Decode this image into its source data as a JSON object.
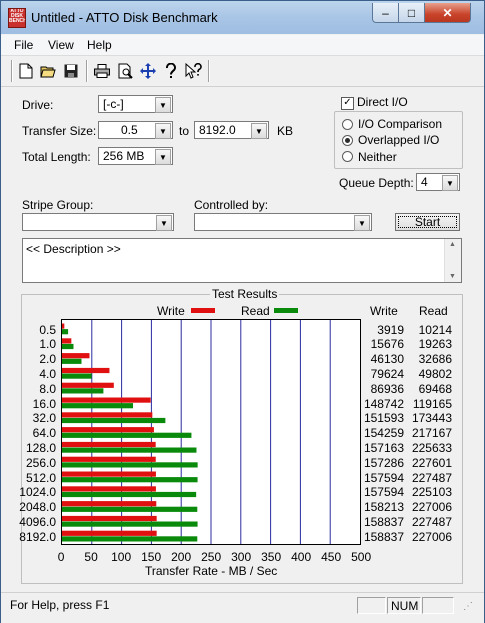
{
  "window": {
    "title": "Untitled - ATTO Disk Benchmark",
    "icon_text": "ATTO DISK BENCH"
  },
  "titlebar_buttons": {
    "minimize": "–",
    "maximize": "□",
    "close": "✕"
  },
  "menu": [
    "File",
    "View",
    "Help"
  ],
  "toolbar": {
    "icons": [
      "new-icon",
      "open-icon",
      "save-icon",
      "print-icon",
      "print-preview-icon",
      "move-icon",
      "help-icon",
      "context-help-icon"
    ]
  },
  "settings": {
    "drive_label": "Drive:",
    "drive_value": "[-c-]",
    "transfer_size_label": "Transfer Size:",
    "transfer_from": "0.5",
    "to_label": "to",
    "transfer_to": "8192.0",
    "kb_label": "KB",
    "total_length_label": "Total Length:",
    "total_length_value": "256 MB",
    "direct_io_label": "Direct I/O",
    "direct_io_checked": true,
    "io_comparison_label": "I/O Comparison",
    "overlapped_io_label": "Overlapped I/O",
    "neither_label": "Neither",
    "selected_mode": "Overlapped I/O",
    "queue_depth_label": "Queue Depth:",
    "queue_depth_value": "4",
    "stripe_group_label": "Stripe Group:",
    "stripe_group_value": "",
    "controlled_by_label": "Controlled by:",
    "controlled_by_value": "",
    "start_button": "Start",
    "description": "<< Description >>"
  },
  "results": {
    "title": "Test Results",
    "legend_write": "Write",
    "legend_read": "Read",
    "col_write": "Write",
    "col_read": "Read",
    "rows": [
      {
        "size": "0.5",
        "write": "3919",
        "read": "10214"
      },
      {
        "size": "1.0",
        "write": "15676",
        "read": "19263"
      },
      {
        "size": "2.0",
        "write": "46130",
        "read": "32686"
      },
      {
        "size": "4.0",
        "write": "79624",
        "read": "49802"
      },
      {
        "size": "8.0",
        "write": "86936",
        "read": "69468"
      },
      {
        "size": "16.0",
        "write": "148742",
        "read": "119165"
      },
      {
        "size": "32.0",
        "write": "151593",
        "read": "173443"
      },
      {
        "size": "64.0",
        "write": "154259",
        "read": "217167"
      },
      {
        "size": "128.0",
        "write": "157163",
        "read": "225633"
      },
      {
        "size": "256.0",
        "write": "157286",
        "read": "227601"
      },
      {
        "size": "512.0",
        "write": "157594",
        "read": "227487"
      },
      {
        "size": "1024.0",
        "write": "157594",
        "read": "225103"
      },
      {
        "size": "2048.0",
        "write": "158213",
        "read": "227006"
      },
      {
        "size": "4096.0",
        "write": "158837",
        "read": "227487"
      },
      {
        "size": "8192.0",
        "write": "158837",
        "read": "227006"
      }
    ]
  },
  "chart_data": {
    "type": "bar",
    "orientation": "horizontal",
    "categories": [
      "0.5",
      "1.0",
      "2.0",
      "4.0",
      "8.0",
      "16.0",
      "32.0",
      "64.0",
      "128.0",
      "256.0",
      "512.0",
      "1024.0",
      "2048.0",
      "4096.0",
      "8192.0"
    ],
    "series": [
      {
        "name": "Write",
        "color": "#e01010",
        "values": [
          3.919,
          15.676,
          46.13,
          79.624,
          86.936,
          148.742,
          151.593,
          154.259,
          157.163,
          157.286,
          157.594,
          157.594,
          158.213,
          158.837,
          158.837
        ]
      },
      {
        "name": "Read",
        "color": "#0a8a0a",
        "values": [
          10.214,
          19.263,
          32.686,
          49.802,
          69.468,
          119.165,
          173.443,
          217.167,
          225.633,
          227.601,
          227.487,
          225.103,
          227.006,
          227.487,
          227.006
        ]
      }
    ],
    "xlabel": "Transfer Rate - MB / Sec",
    "xticks": [
      "0",
      "50",
      "100",
      "150",
      "200",
      "250",
      "300",
      "350",
      "400",
      "450",
      "500"
    ],
    "xlim": [
      0,
      500
    ],
    "grid": "vertical",
    "legend": "top"
  },
  "statusbar": {
    "help_text": "For Help, press F1",
    "num": "NUM"
  }
}
